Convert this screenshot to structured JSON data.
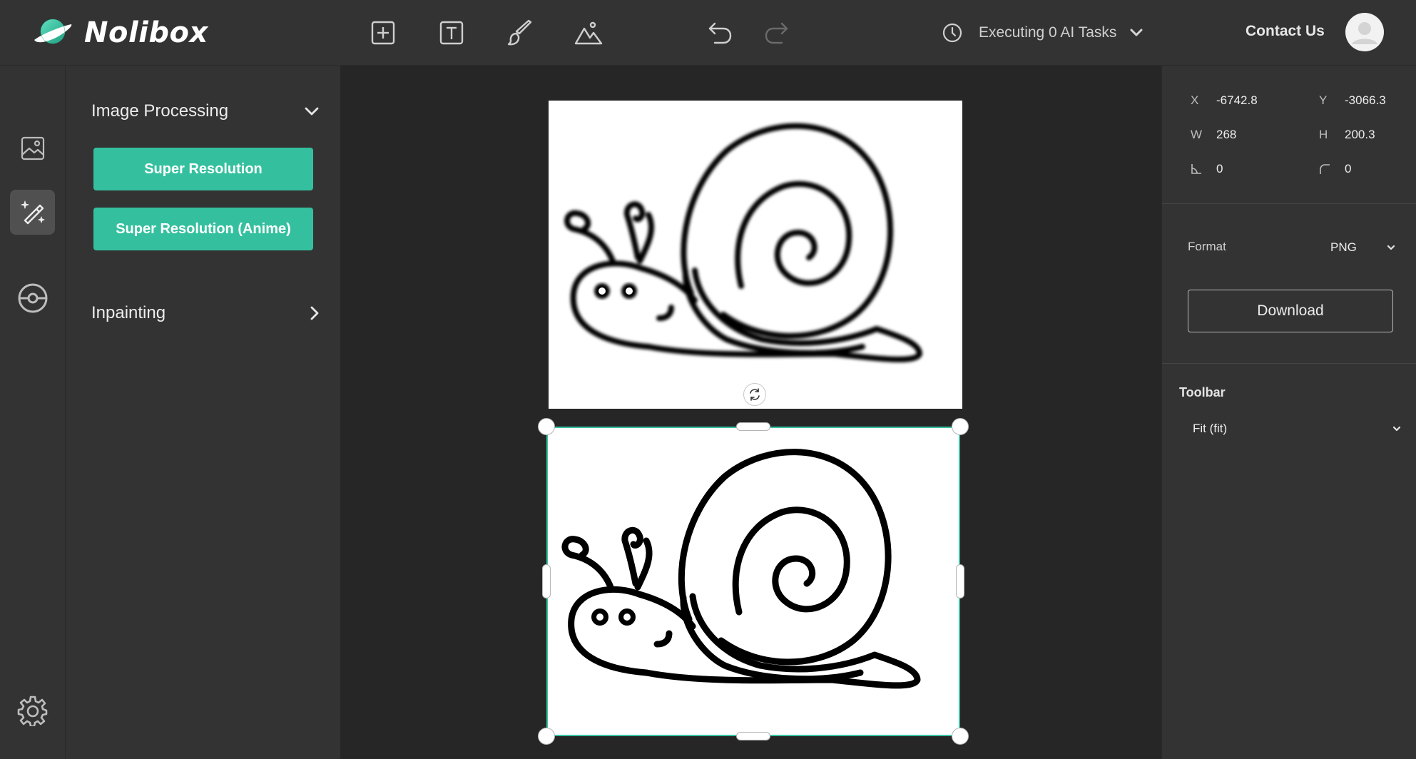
{
  "app": {
    "name": "Nolibox"
  },
  "header": {
    "tools": [
      {
        "icon": "add-frame-icon"
      },
      {
        "icon": "text-icon"
      },
      {
        "icon": "brush-icon"
      },
      {
        "icon": "image-mountain-icon"
      }
    ],
    "undo_icon": "undo-icon",
    "redo_icon": "redo-icon",
    "tasks_label": "Executing 0 AI Tasks",
    "contact_label": "Contact Us"
  },
  "sidebar": {
    "items": [
      {
        "icon": "image-icon",
        "active": false
      },
      {
        "icon": "magic-wand-icon",
        "active": true
      },
      {
        "icon": "pokeball-icon",
        "active": false
      },
      {
        "icon": "gear-icon",
        "active": false
      }
    ]
  },
  "panel": {
    "sections": [
      {
        "title": "Image Processing",
        "expanded": true,
        "buttons": [
          "Super Resolution",
          "Super Resolution (Anime)"
        ]
      },
      {
        "title": "Inpainting",
        "expanded": false,
        "buttons": []
      }
    ]
  },
  "properties": {
    "x_key": "X",
    "x_value": "-6742.8",
    "y_key": "Y",
    "y_value": "-3066.3",
    "w_key": "W",
    "w_value": "268",
    "h_key": "H",
    "h_value": "200.3",
    "skew_value": "0",
    "radius_value": "0",
    "format_label": "Format",
    "format_value": "PNG",
    "download_label": "Download",
    "toolbar_label": "Toolbar",
    "toolbar_value": "Fit (fit)"
  },
  "colors": {
    "accent": "#34c09e",
    "selection": "#39c3a2",
    "header_bg": "#333333",
    "canvas_bg": "#262626"
  }
}
